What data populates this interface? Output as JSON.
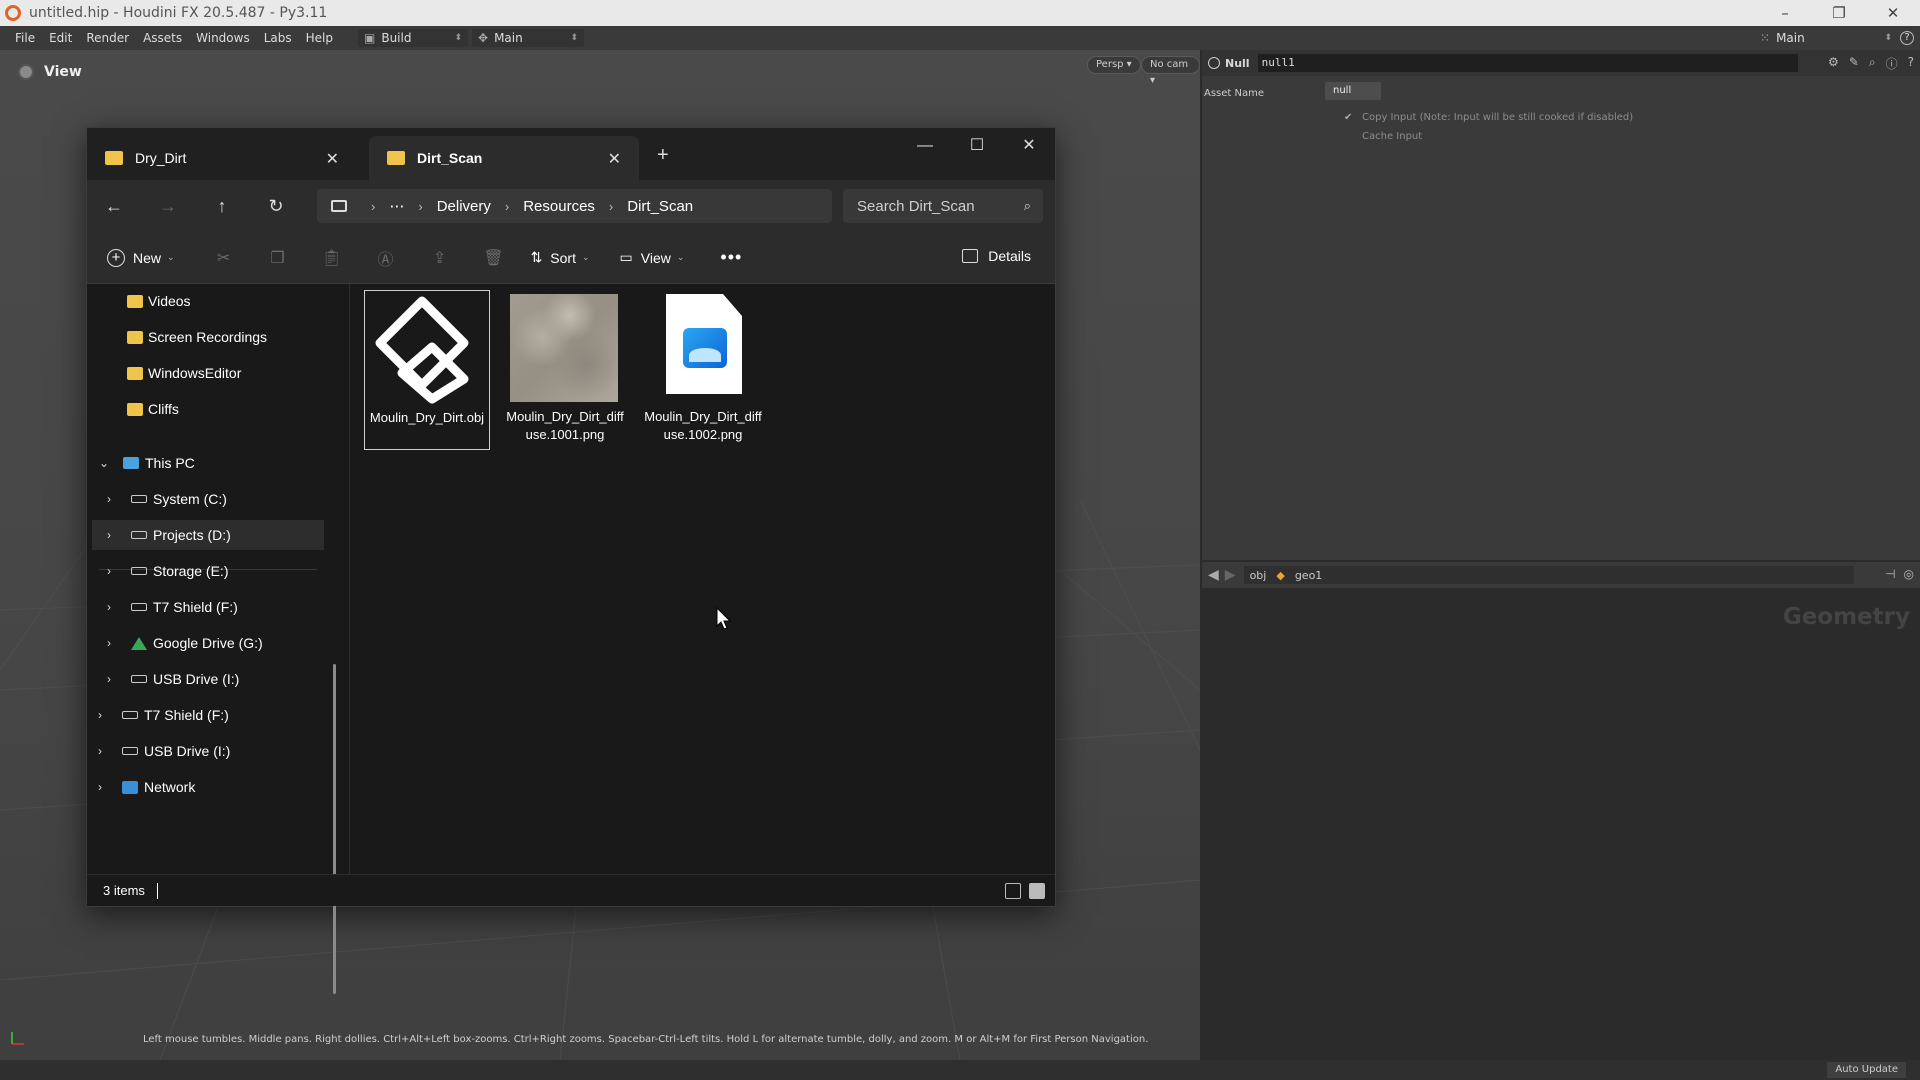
{
  "houdini": {
    "title": "untitled.hip - Houdini FX 20.5.487 - Py3.11",
    "menus": [
      "File",
      "Edit",
      "Render",
      "Assets",
      "Windows",
      "Labs",
      "Help"
    ],
    "desktop_build": "Build",
    "desktop_main": "Main",
    "right_desktop": "Main",
    "viewport": {
      "label": "View",
      "persp_btn": "Persp ▾",
      "cam_btn": "No cam ▾",
      "hint": "Left mouse tumbles. Middle pans. Right dollies. Ctrl+Alt+Left box-zooms. Ctrl+Right zooms. Spacebar-Ctrl-Left tilts. Hold L for alternate tumble, dolly, and zoom. M or Alt+M for First Person Navigation."
    },
    "params": {
      "node_type": "Null",
      "node_name": "null1",
      "asset_name_label": "Asset Name",
      "asset_name_value": "null",
      "copy_input": "Copy Input (Note: Input will be still cooked if disabled)",
      "cache_input": "Cache Input"
    },
    "network": {
      "path_obj": "obj",
      "path_geo": "geo1",
      "watermark": "Geometry"
    },
    "status": {
      "auto_update": "Auto Update"
    }
  },
  "explorer": {
    "tabs": [
      {
        "label": "Dry_Dirt"
      },
      {
        "label": "Dirt_Scan"
      }
    ],
    "breadcrumb": [
      "Delivery",
      "Resources",
      "Dirt_Scan"
    ],
    "search_placeholder": "Search Dirt_Scan",
    "toolbar": {
      "new": "New",
      "sort": "Sort",
      "view": "View",
      "details": "Details"
    },
    "sidebar": {
      "folders": [
        "Videos",
        "Screen Recordings",
        "WindowsEditor",
        "Cliffs"
      ],
      "this_pc": "This PC",
      "drives": [
        "System (C:)",
        "Projects (D:)",
        "Storage (E:)",
        "T7 Shield (F:)",
        "Google Drive (G:)",
        "USB Drive (I:)"
      ],
      "root_items": [
        "T7 Shield (F:)",
        "USB Drive (I:)",
        "Network"
      ]
    },
    "files": [
      {
        "name": "Moulin_Dry_Dirt.obj"
      },
      {
        "name": "Moulin_Dry_Dirt_diffuse.1001.png"
      },
      {
        "name": "Moulin_Dry_Dirt_diffuse.1002.png"
      }
    ],
    "status": "3 items",
    "colors": {
      "folder": "#f0c44b",
      "window_bg": "#191919",
      "toolbar_bg": "#2c2c2c"
    }
  }
}
